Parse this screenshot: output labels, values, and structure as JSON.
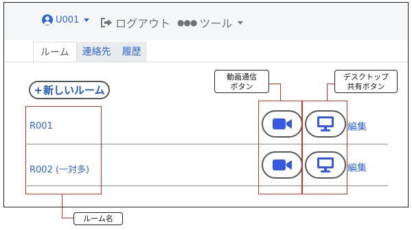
{
  "navbar": {
    "user_label": "U001",
    "logout_label": "ログアウト",
    "tools_label": "ツール"
  },
  "tabs": [
    {
      "label": "ルーム",
      "active": true
    },
    {
      "label": "連絡先",
      "active": false
    },
    {
      "label": "履歴",
      "active": false
    }
  ],
  "new_room_button": {
    "plus": "+",
    "label": "新しいルーム"
  },
  "rooms": [
    {
      "name": "R001",
      "edit_label": "編集"
    },
    {
      "name": "R002 (一対多)",
      "edit_label": "編集"
    }
  ],
  "annotations": {
    "video_call_button": [
      "動画通信",
      "ボタン"
    ],
    "desktop_share_button": [
      "デスクトップ",
      "共有ボタン"
    ],
    "room_name": "ルーム名"
  },
  "colors": {
    "accent": "#2f64d8",
    "annotation_red": "#c0392b",
    "navbar_bg": "#f5f6f7"
  },
  "icons": {
    "user": "user-circle-icon",
    "logout": "logout-icon",
    "tools": "ellipsis-icon",
    "video": "video-camera-icon",
    "screen": "desktop-monitor-icon"
  }
}
